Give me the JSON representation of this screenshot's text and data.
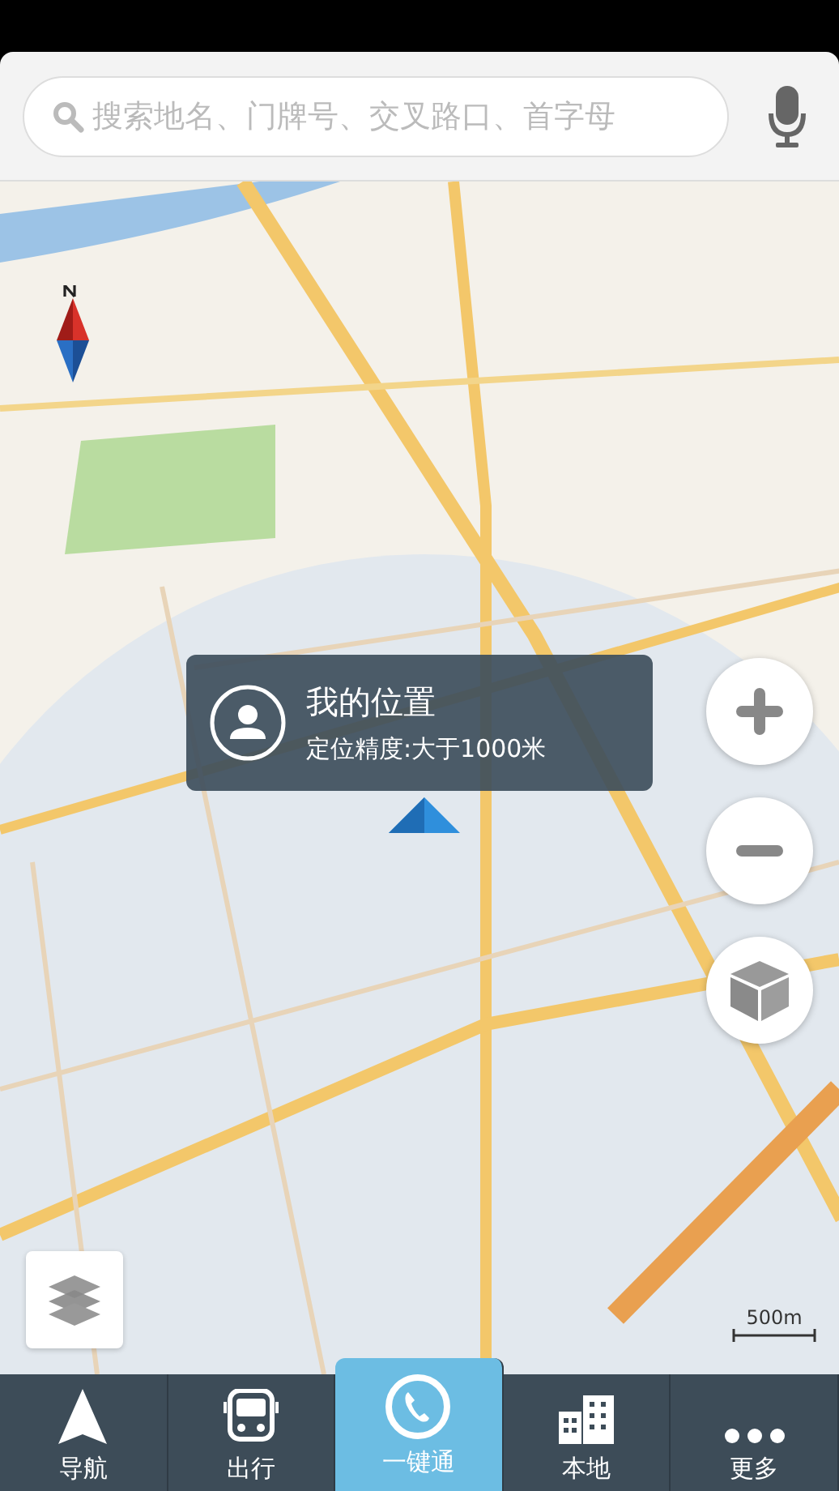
{
  "search": {
    "placeholder": "搜索地名、门牌号、交叉路口、首字母"
  },
  "location_popup": {
    "title": "我的位置",
    "accuracy": "定位精度:大于1000米"
  },
  "scale_label": "500m",
  "tabs": [
    {
      "label": "导航",
      "kind": "navigate",
      "selected": false
    },
    {
      "label": "出行",
      "kind": "bus",
      "selected": false
    },
    {
      "label": "一键通",
      "kind": "phone",
      "selected": true
    },
    {
      "label": "本地",
      "kind": "buildings",
      "selected": false
    },
    {
      "label": "更多",
      "kind": "more",
      "selected": false
    }
  ]
}
